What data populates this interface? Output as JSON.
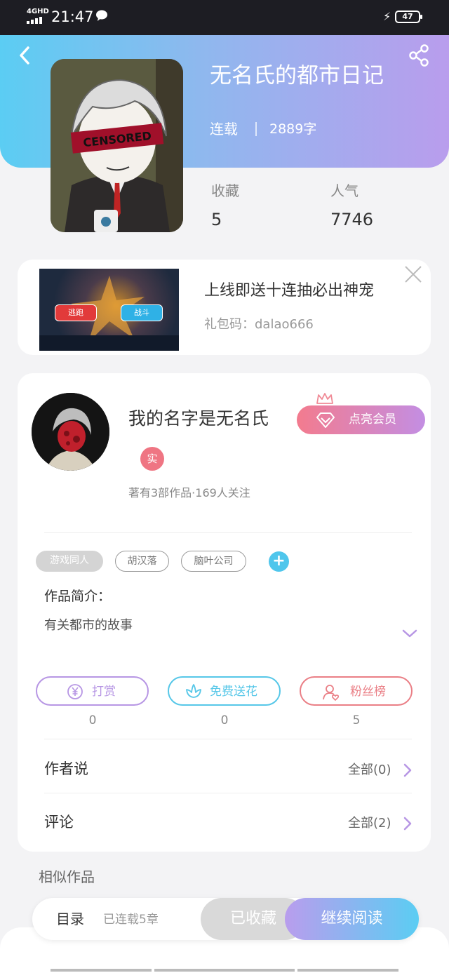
{
  "status_bar": {
    "network": "4GHD",
    "time": "21:47",
    "battery": "47"
  },
  "header": {
    "back_icon": "back-arrow-icon",
    "share_icon": "share-icon",
    "title": "无名氏的都市日记",
    "status": "连载",
    "word_count": "2889字",
    "stats": [
      {
        "label": "收藏",
        "value": "5"
      },
      {
        "label": "人气",
        "value": "7746"
      }
    ]
  },
  "ad": {
    "title": "上线即送十连抽必出神宠",
    "code": "礼包码：dalao666",
    "buttons": [
      "逃跑",
      "战斗"
    ]
  },
  "author": {
    "name": "我的名字是无名氏",
    "vip_button": "点亮会员",
    "badge": "实",
    "meta": "著有3部作品·169人关注",
    "tags": [
      "游戏同人",
      "胡汉落",
      "脑叶公司"
    ],
    "intro_title": "作品简介：",
    "intro_text": "有关都市的故事",
    "actions": [
      {
        "label": "打赏",
        "count": "0",
        "color": "#b796e4",
        "icon": "yen-icon"
      },
      {
        "label": "免费送花",
        "count": "0",
        "color": "#56c7e8",
        "icon": "flower-icon"
      },
      {
        "label": "粉丝榜",
        "count": "5",
        "color": "#ea7f86",
        "icon": "fans-icon"
      }
    ],
    "rows": [
      {
        "label": "作者说",
        "right": "全部(0)"
      },
      {
        "label": "评论",
        "right": "全部(2)"
      }
    ]
  },
  "similar_title": "相似作品",
  "bottom_bar": {
    "toc": "目录",
    "chapters": "已连载5章",
    "collected": "已收藏",
    "continue": "继续阅读"
  }
}
